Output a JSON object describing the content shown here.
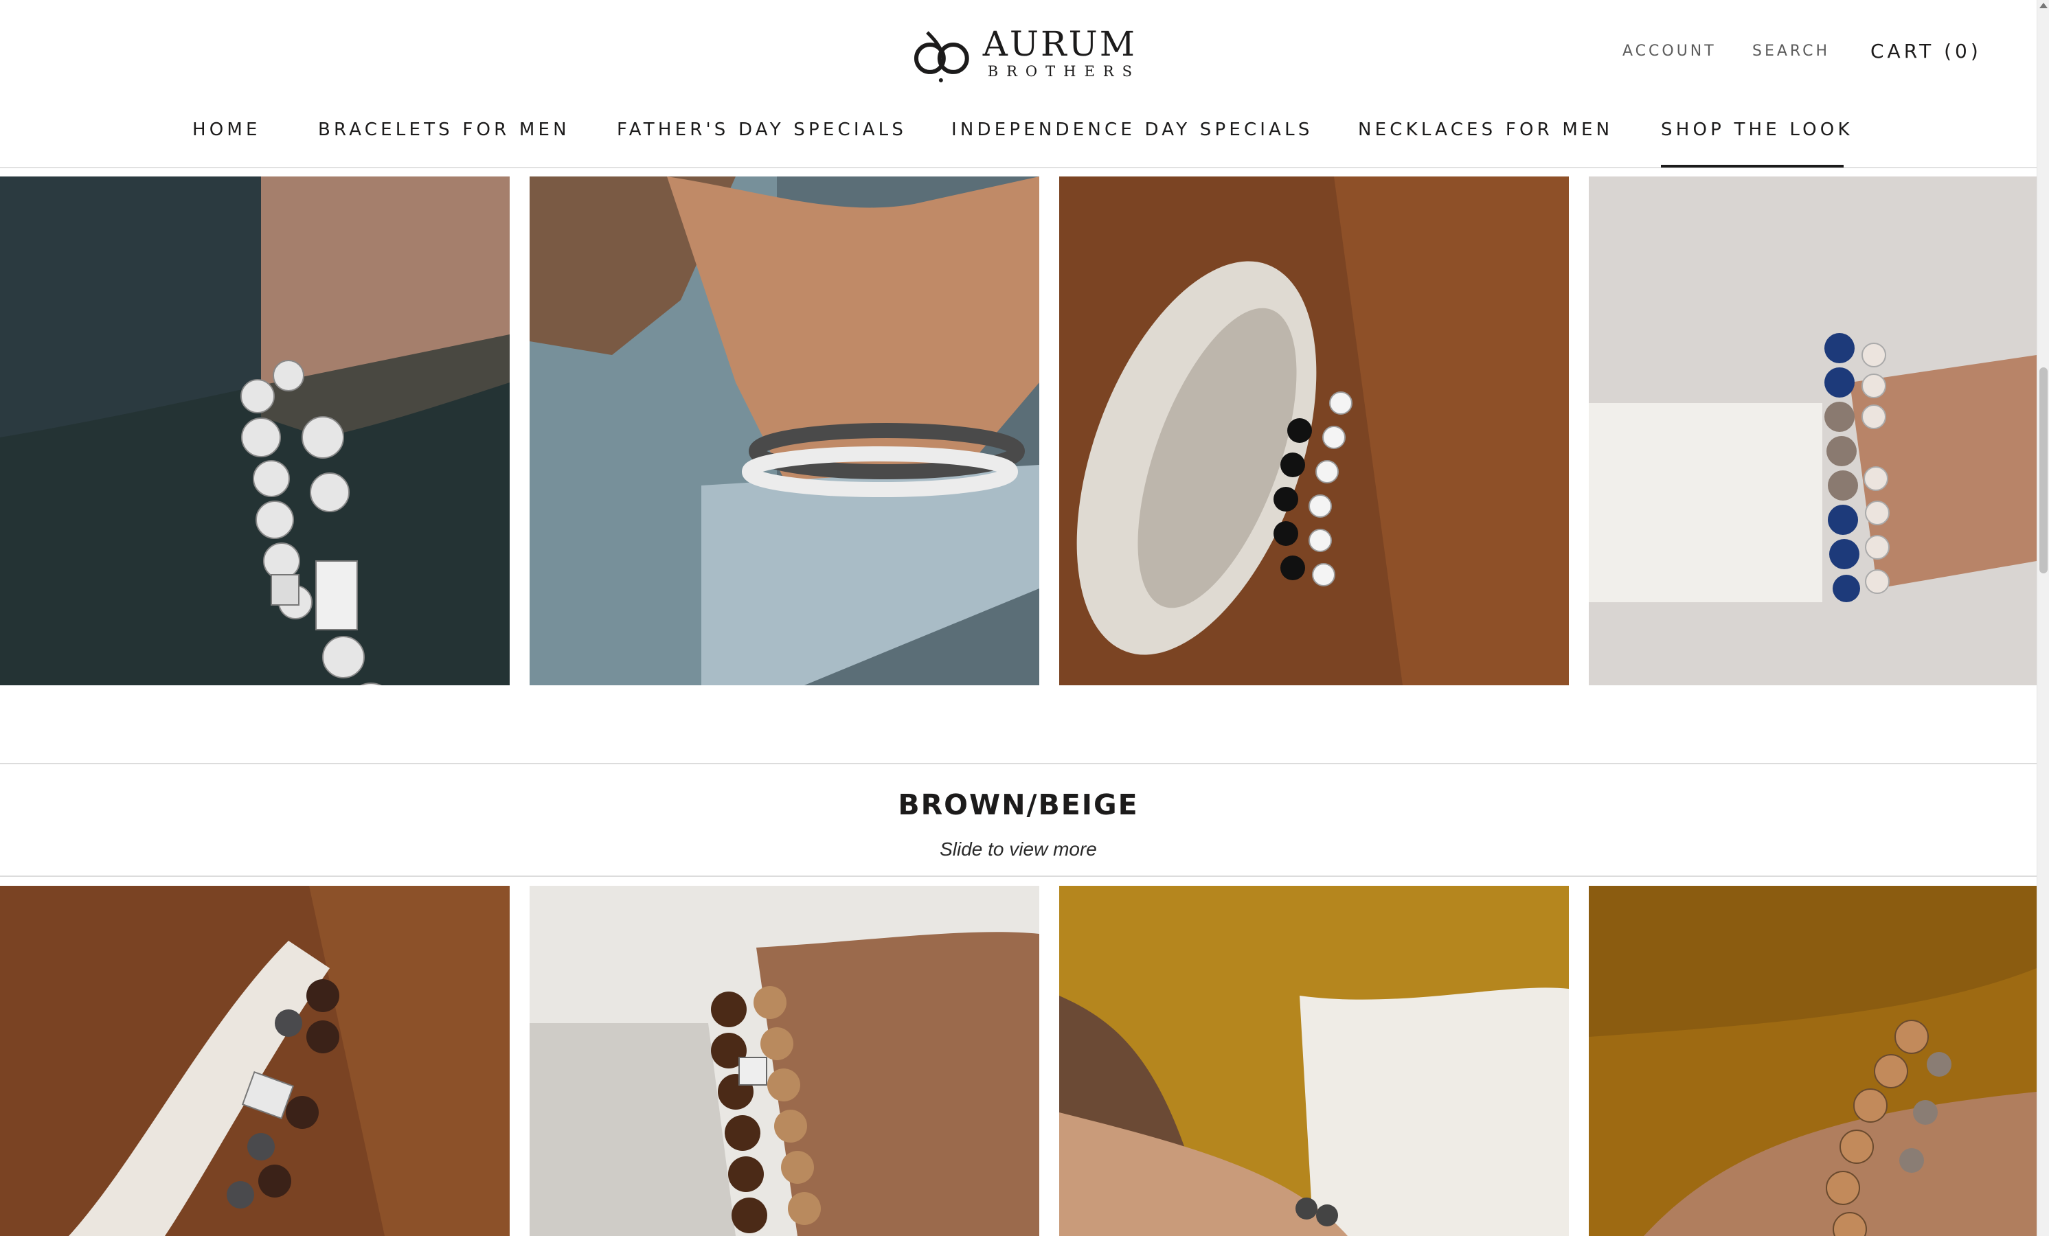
{
  "brand": {
    "name": "AURUM",
    "sub": "BROTHERS"
  },
  "utility": {
    "account": "ACCOUNT",
    "search": "SEARCH",
    "cart": "CART (0)"
  },
  "nav": {
    "items": [
      {
        "label": "HOME"
      },
      {
        "label": "BRACELETS FOR MEN"
      },
      {
        "label": "FATHER'S DAY SPECIALS"
      },
      {
        "label": "INDEPENDENCE DAY SPECIALS"
      },
      {
        "label": "NECKLACES FOR MEN"
      },
      {
        "label": "SHOP THE LOOK"
      }
    ],
    "active_index": 5
  },
  "section": {
    "title": "BROWN/BEIGE",
    "subtitle": "Slide to view more"
  },
  "colors": {
    "text": "#1c1b1b",
    "muted": "#5c5c5c",
    "divider": "#dcdcdc"
  }
}
